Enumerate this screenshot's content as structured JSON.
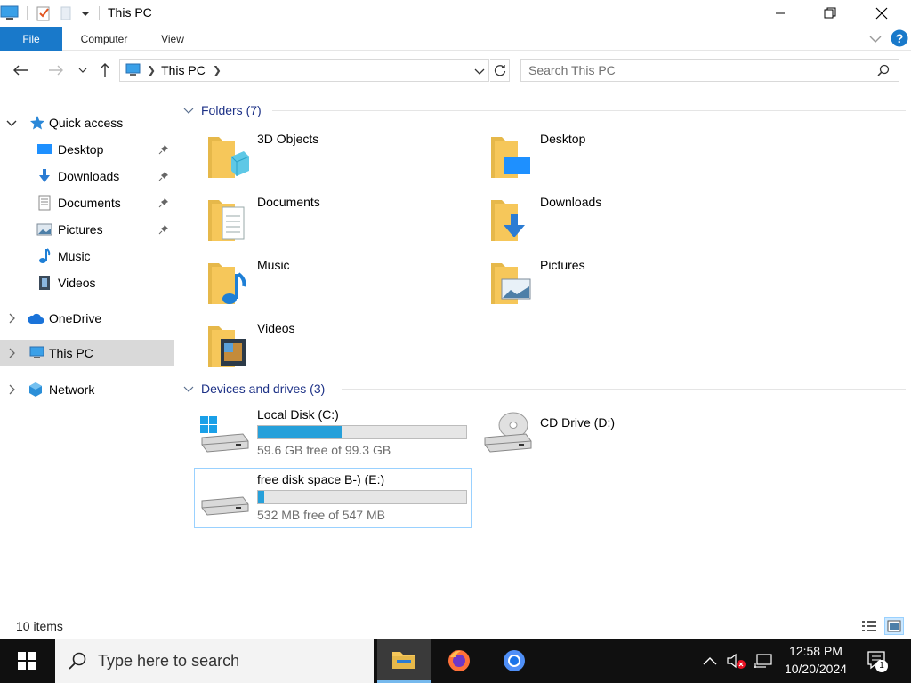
{
  "window": {
    "title": "This PC"
  },
  "ribbon": {
    "tabs": [
      "File",
      "Computer",
      "View"
    ]
  },
  "address": {
    "crumb": "This PC",
    "search_placeholder": "Search This PC"
  },
  "navpane": {
    "items": [
      {
        "label": "Quick access",
        "pinned": false
      },
      {
        "label": "Desktop",
        "pinned": true
      },
      {
        "label": "Downloads",
        "pinned": true
      },
      {
        "label": "Documents",
        "pinned": true
      },
      {
        "label": "Pictures",
        "pinned": true
      },
      {
        "label": "Music",
        "pinned": false
      },
      {
        "label": "Videos",
        "pinned": false
      },
      {
        "label": "OneDrive",
        "pinned": false
      },
      {
        "label": "This PC",
        "pinned": false,
        "selected": true
      },
      {
        "label": "Network",
        "pinned": false
      }
    ]
  },
  "content": {
    "folders_header": "Folders (7)",
    "folders": [
      "3D Objects",
      "Desktop",
      "Documents",
      "Downloads",
      "Music",
      "Pictures",
      "Videos"
    ],
    "drives_header": "Devices and drives (3)",
    "drives": [
      {
        "name": "Local Disk (C:)",
        "free_text": "59.6 GB free of 99.3 GB",
        "used_fraction": 0.4
      },
      {
        "name": "CD Drive (D:)",
        "free_text": "",
        "used_fraction": null
      },
      {
        "name": "free disk space B-) (E:)",
        "free_text": "532 MB free of 547 MB",
        "used_fraction": 0.03
      }
    ]
  },
  "status": {
    "items_count": "10 items"
  },
  "taskbar": {
    "search_placeholder": "Type here to search",
    "time": "12:58 PM",
    "date": "10/20/2024",
    "notification_count": "1"
  },
  "colors": {
    "accent": "#1979ca",
    "drive_bar": "#26a0da",
    "group_header": "#1e3287",
    "folder_yellow": "#f6c75a"
  }
}
